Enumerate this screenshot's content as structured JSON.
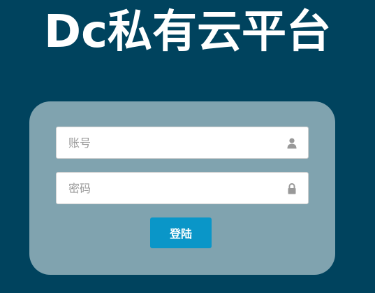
{
  "title": "Dc私有云平台",
  "login_form": {
    "username_placeholder": "账号",
    "username_icon": "user-icon",
    "password_placeholder": "密码",
    "password_icon": "lock-icon",
    "submit_label": "登陆"
  },
  "colors": {
    "background": "#00435e",
    "panel": "#80a3af",
    "button": "#0a96c8",
    "icon": "#999999"
  }
}
